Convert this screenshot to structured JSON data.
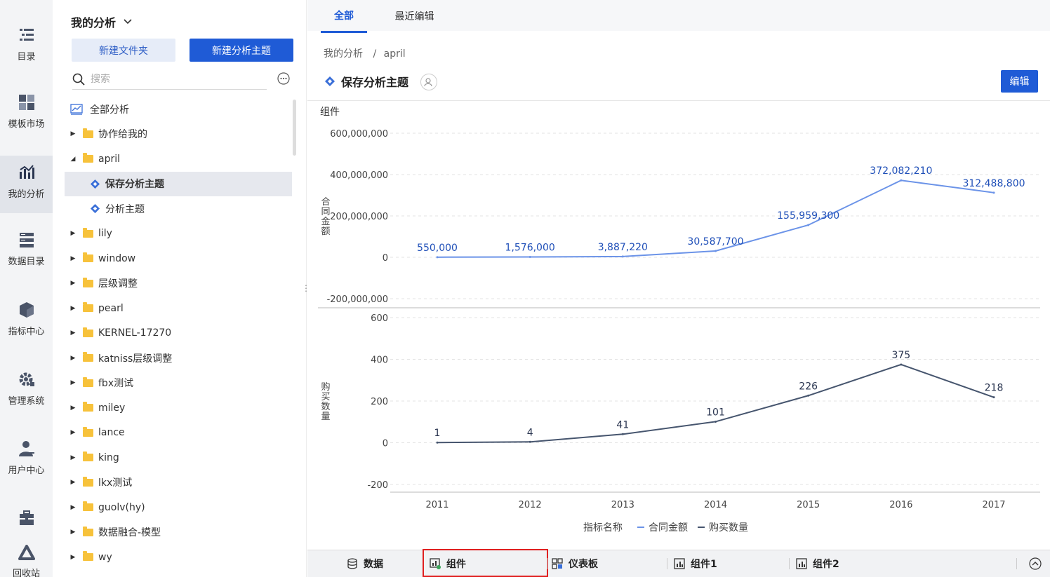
{
  "nav": {
    "items": [
      {
        "label": "目录",
        "icon": "catalog-icon"
      },
      {
        "label": "模板市场",
        "icon": "template-icon"
      },
      {
        "label": "我的分析",
        "icon": "analysis-icon",
        "active": true
      },
      {
        "label": "数据目录",
        "icon": "data-catalog-icon"
      },
      {
        "label": "指标中心",
        "icon": "metric-icon"
      },
      {
        "label": "管理系统",
        "icon": "gear-icon"
      },
      {
        "label": "用户中心",
        "icon": "user-icon"
      },
      {
        "label": "",
        "icon": "toolbox-icon"
      },
      {
        "label": "回收站",
        "icon": "recycle-icon"
      }
    ]
  },
  "tree": {
    "title": "我的分析",
    "new_folder": "新建文件夹",
    "new_theme": "新建分析主题",
    "search_placeholder": "搜索",
    "root": "全部分析",
    "items": [
      {
        "label": "协作给我的",
        "type": "folder",
        "level": 1,
        "arrow": "▶"
      },
      {
        "label": "april",
        "type": "folder",
        "level": 1,
        "arrow": "◢"
      },
      {
        "label": "保存分析主题",
        "type": "theme",
        "level": 2,
        "selected": true
      },
      {
        "label": "分析主题",
        "type": "theme",
        "level": 2
      },
      {
        "label": "lily",
        "type": "folder",
        "level": 1,
        "arrow": "▶"
      },
      {
        "label": "window",
        "type": "folder",
        "level": 1,
        "arrow": "▶"
      },
      {
        "label": "层级调整",
        "type": "folder",
        "level": 1,
        "arrow": "▶"
      },
      {
        "label": "pearl",
        "type": "folder",
        "level": 1,
        "arrow": "▶"
      },
      {
        "label": "KERNEL-17270",
        "type": "folder",
        "level": 1,
        "arrow": "▶"
      },
      {
        "label": "katniss层级调整",
        "type": "folder",
        "level": 1,
        "arrow": "▶"
      },
      {
        "label": "fbx测试",
        "type": "folder",
        "level": 1,
        "arrow": "▶"
      },
      {
        "label": "miley",
        "type": "folder",
        "level": 1,
        "arrow": "▶"
      },
      {
        "label": "lance",
        "type": "folder",
        "level": 1,
        "arrow": "▶"
      },
      {
        "label": "king",
        "type": "folder",
        "level": 1,
        "arrow": "▶"
      },
      {
        "label": "lkx测试",
        "type": "folder",
        "level": 1,
        "arrow": "▶"
      },
      {
        "label": "guolv(hy)",
        "type": "folder",
        "level": 1,
        "arrow": "▶"
      },
      {
        "label": "数据融合-模型",
        "type": "folder",
        "level": 1,
        "arrow": "▶"
      },
      {
        "label": "wy",
        "type": "folder",
        "level": 1,
        "arrow": "▶"
      }
    ]
  },
  "main": {
    "tabs": [
      "全部",
      "最近编辑"
    ],
    "breadcrumb": [
      "我的分析",
      "/",
      "april"
    ],
    "title": "保存分析主题",
    "edit": "编辑",
    "component_label": "组件"
  },
  "bottom": {
    "tabs": [
      "数据",
      "组件",
      "仪表板",
      "组件1",
      "组件2"
    ]
  },
  "colors": {
    "primary": "#1f5bd6",
    "series1": "#6b93e8",
    "series2": "#46556e",
    "highlight": "#e02020"
  },
  "chart_data": {
    "type": "line",
    "x": [
      "2011",
      "2012",
      "2013",
      "2014",
      "2015",
      "2016",
      "2017"
    ],
    "legend_title": "指标名称",
    "legend_position": "bottom",
    "grid": true,
    "panels": [
      {
        "ylabel": "合同金额",
        "ylim": [
          -200000000,
          600000000
        ],
        "ticks": [
          600000000,
          400000000,
          200000000,
          0,
          -200000000
        ],
        "tick_labels": [
          "600,000,000",
          "400,000,000",
          "200,000,000",
          "0",
          "-200,000,000"
        ],
        "series": {
          "name": "合同金额",
          "values": [
            550000,
            1576000,
            3887220,
            30587700,
            155959300,
            372082210,
            312488800
          ],
          "labels": [
            "550,000",
            "1,576,000",
            "3,887,220",
            "30,587,700",
            "155,959,300",
            "372,082,210",
            "312,488,800"
          ]
        }
      },
      {
        "ylabel": "购买数量",
        "ylim": [
          -200,
          600
        ],
        "ticks": [
          600,
          400,
          200,
          0,
          -200
        ],
        "tick_labels": [
          "600",
          "400",
          "200",
          "0",
          "-200"
        ],
        "series": {
          "name": "购买数量",
          "values": [
            1,
            4,
            41,
            101,
            226,
            375,
            218
          ],
          "labels": [
            "1",
            "4",
            "41",
            "101",
            "226",
            "375",
            "218"
          ]
        }
      }
    ]
  }
}
